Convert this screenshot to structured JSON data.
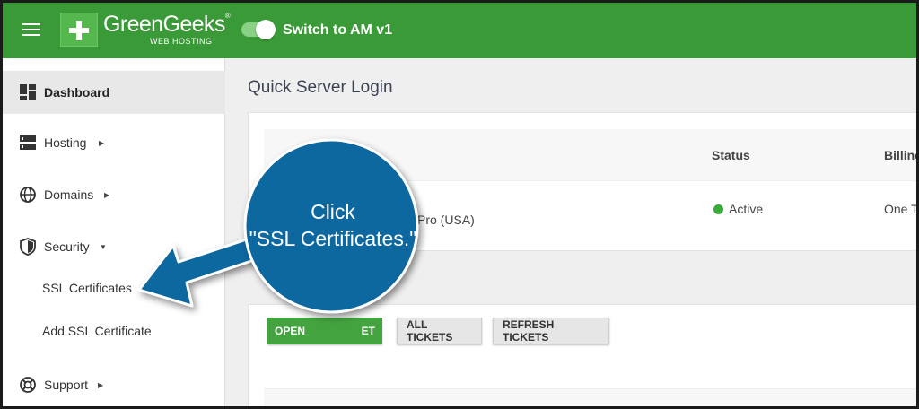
{
  "header": {
    "logo_name": "GreenGeeks",
    "logo_reg": "®",
    "logo_sub": "WEB HOSTING",
    "switch_label": "Switch to AM v1",
    "bg_color": "#3a9a37"
  },
  "sidebar": {
    "items": [
      {
        "label": "Dashboard",
        "icon": "dashboard-icon"
      },
      {
        "label": "Hosting",
        "icon": "server-icon"
      },
      {
        "label": "Domains",
        "icon": "globe-icon"
      },
      {
        "label": "Security",
        "icon": "shield-icon"
      },
      {
        "label": "Support",
        "icon": "lifebuoy-icon"
      }
    ],
    "subitems": [
      {
        "label": "SSL Certificates"
      },
      {
        "label": "Add SSL Certificate"
      }
    ]
  },
  "main": {
    "title": "Quick Server Login",
    "table": {
      "columns": [
        "Status",
        "Billing"
      ],
      "row": {
        "plan_partial": "Pro (USA)",
        "status": "Active",
        "billing_partial": "One Ti"
      }
    },
    "tickets": {
      "open_label_partial": "OPEN",
      "open_label_tail": "ET",
      "all_label": "ALL TICKETS",
      "refresh_label": "REFRESH TICKETS"
    }
  },
  "callout": {
    "line1": "Click",
    "line2": "\"SSL Certificates.\"",
    "color": "#0a67a0"
  }
}
